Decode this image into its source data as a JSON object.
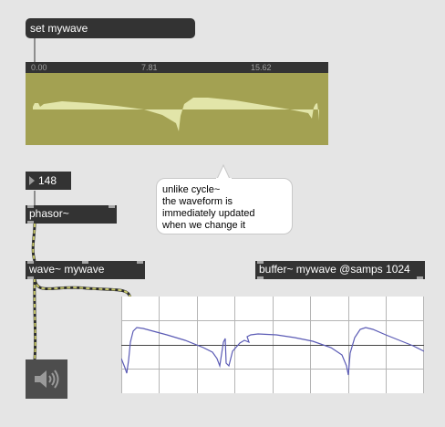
{
  "message": {
    "label": "set mywave"
  },
  "waveform_editor": {
    "ruler_ticks": [
      "0.00",
      "7.81",
      "15.62"
    ],
    "background": "#a3a152",
    "wave_color": "#e2e5a9"
  },
  "number": {
    "value": "148"
  },
  "objects": {
    "phasor": "phasor~",
    "wave": "wave~ mywave",
    "buffer": "buffer~ mywave @samps 1024"
  },
  "comment": {
    "lines": [
      "unlike cycle~",
      "the waveform is",
      "immediately updated",
      "when we change it"
    ]
  },
  "scope": {
    "line_color": "#5b5bb5",
    "grid": true
  },
  "dac": {
    "icon": "speaker-icon"
  }
}
